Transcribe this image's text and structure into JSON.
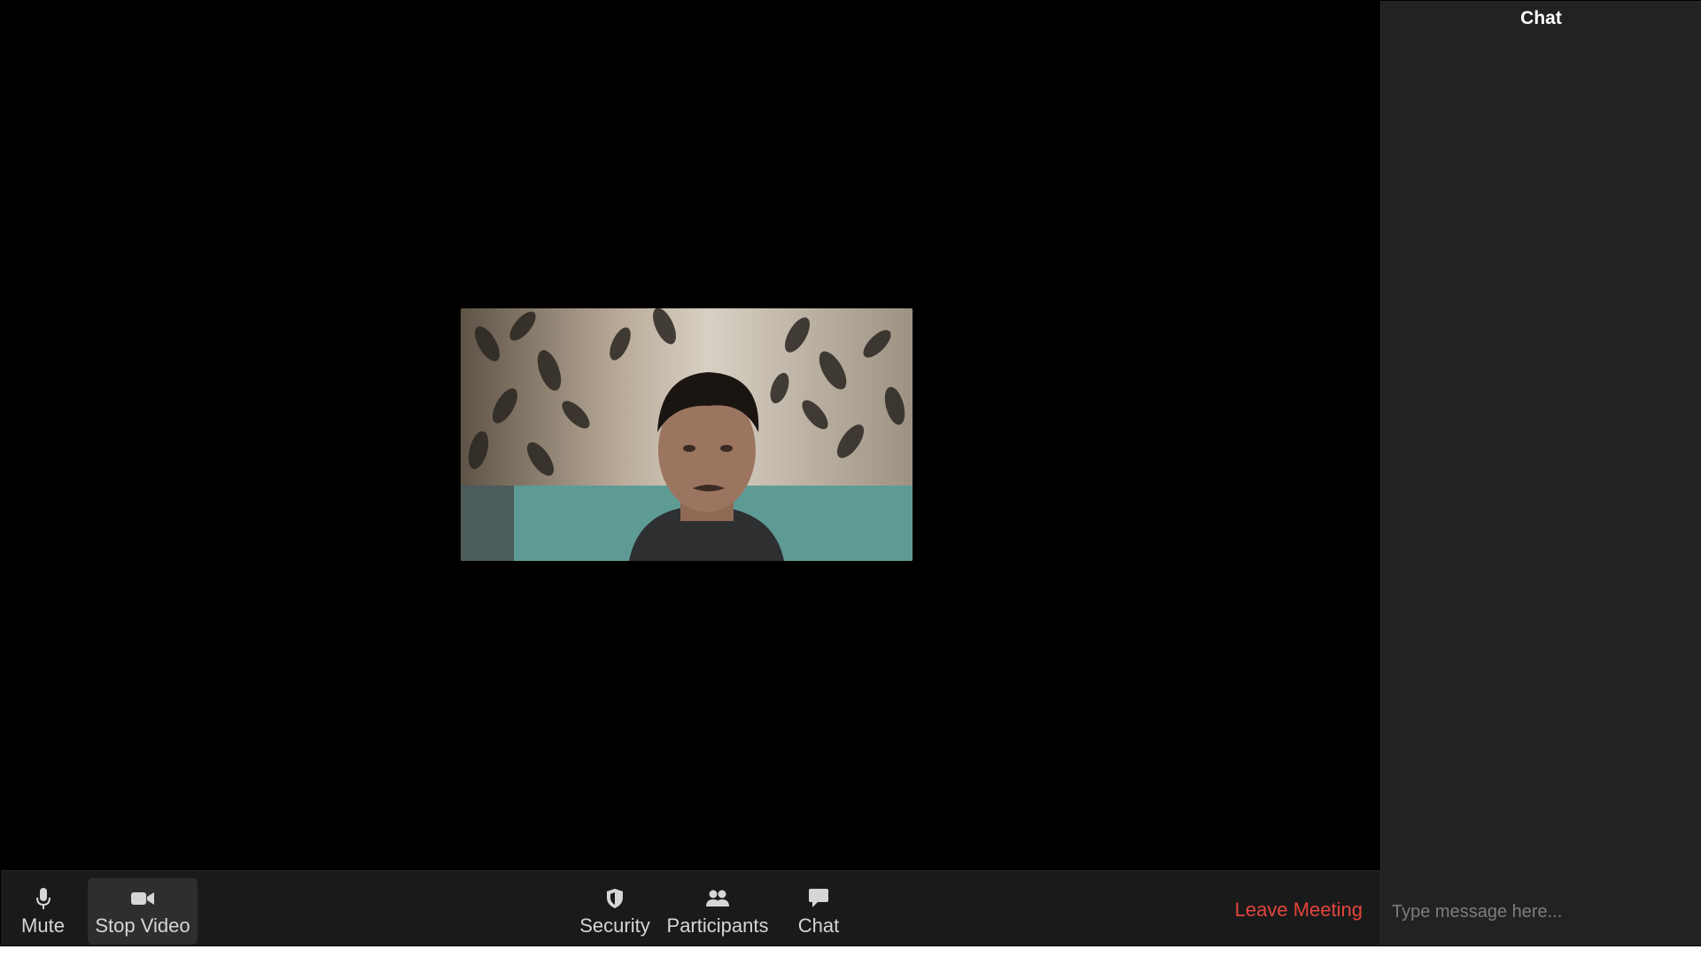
{
  "meeting": {
    "participant_video_label": "participant video"
  },
  "toolbar": {
    "mute_label": "Mute",
    "stop_video_label": "Stop Video",
    "security_label": "Security",
    "participants_label": "Participants",
    "chat_label": "Chat",
    "leave_label": "Leave Meeting",
    "icons": {
      "mute": "microphone-icon",
      "stop_video": "video-camera-icon",
      "security": "shield-icon",
      "participants": "participants-icon",
      "chat": "chat-bubble-icon"
    },
    "leave_color": "#e2453d"
  },
  "chat": {
    "title": "Chat",
    "input_placeholder": "Type message here..."
  }
}
